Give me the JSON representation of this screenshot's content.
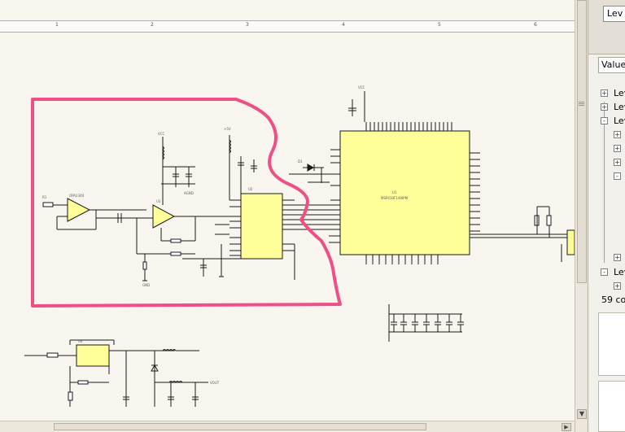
{
  "toolbar": {
    "ruler_labels": [
      "1",
      "2",
      "3",
      "4",
      "5",
      "6"
    ]
  },
  "panel": {
    "combo_text": "Lev",
    "header_text": "Value",
    "count_text": "59 co",
    "tree_items": [
      {
        "label": "Lev",
        "state": "+"
      },
      {
        "label": "Lev",
        "state": "+"
      },
      {
        "label": "Lev",
        "state": "-"
      },
      {
        "label": "",
        "state": "+"
      },
      {
        "label": "",
        "state": "+"
      },
      {
        "label": "",
        "state": "+"
      },
      {
        "label": "",
        "state": "-"
      },
      {
        "label": "",
        "state": "+"
      },
      {
        "label": "Lev",
        "state": "-"
      },
      {
        "label": "",
        "state": "+"
      }
    ]
  },
  "schematic": {
    "labels": {
      "u1": "U1",
      "u2": "U2",
      "u3": "U3",
      "u4": "U4",
      "mcu": "MSP430F149IPM",
      "opamp": "OPA2340",
      "vcc": "VCC",
      "gnd": "GND",
      "vcc2": "+5V",
      "agnd": "AGND",
      "dgnd": "DGND",
      "vout": "VOUT",
      "r_in": "R1",
      "c1": "C1",
      "d1": "D1"
    },
    "colors": {
      "chip_fill": "#ffff9a",
      "wire": "#1a1a1a",
      "annotation": "#ef4f86",
      "label": "#5e5a52"
    }
  }
}
